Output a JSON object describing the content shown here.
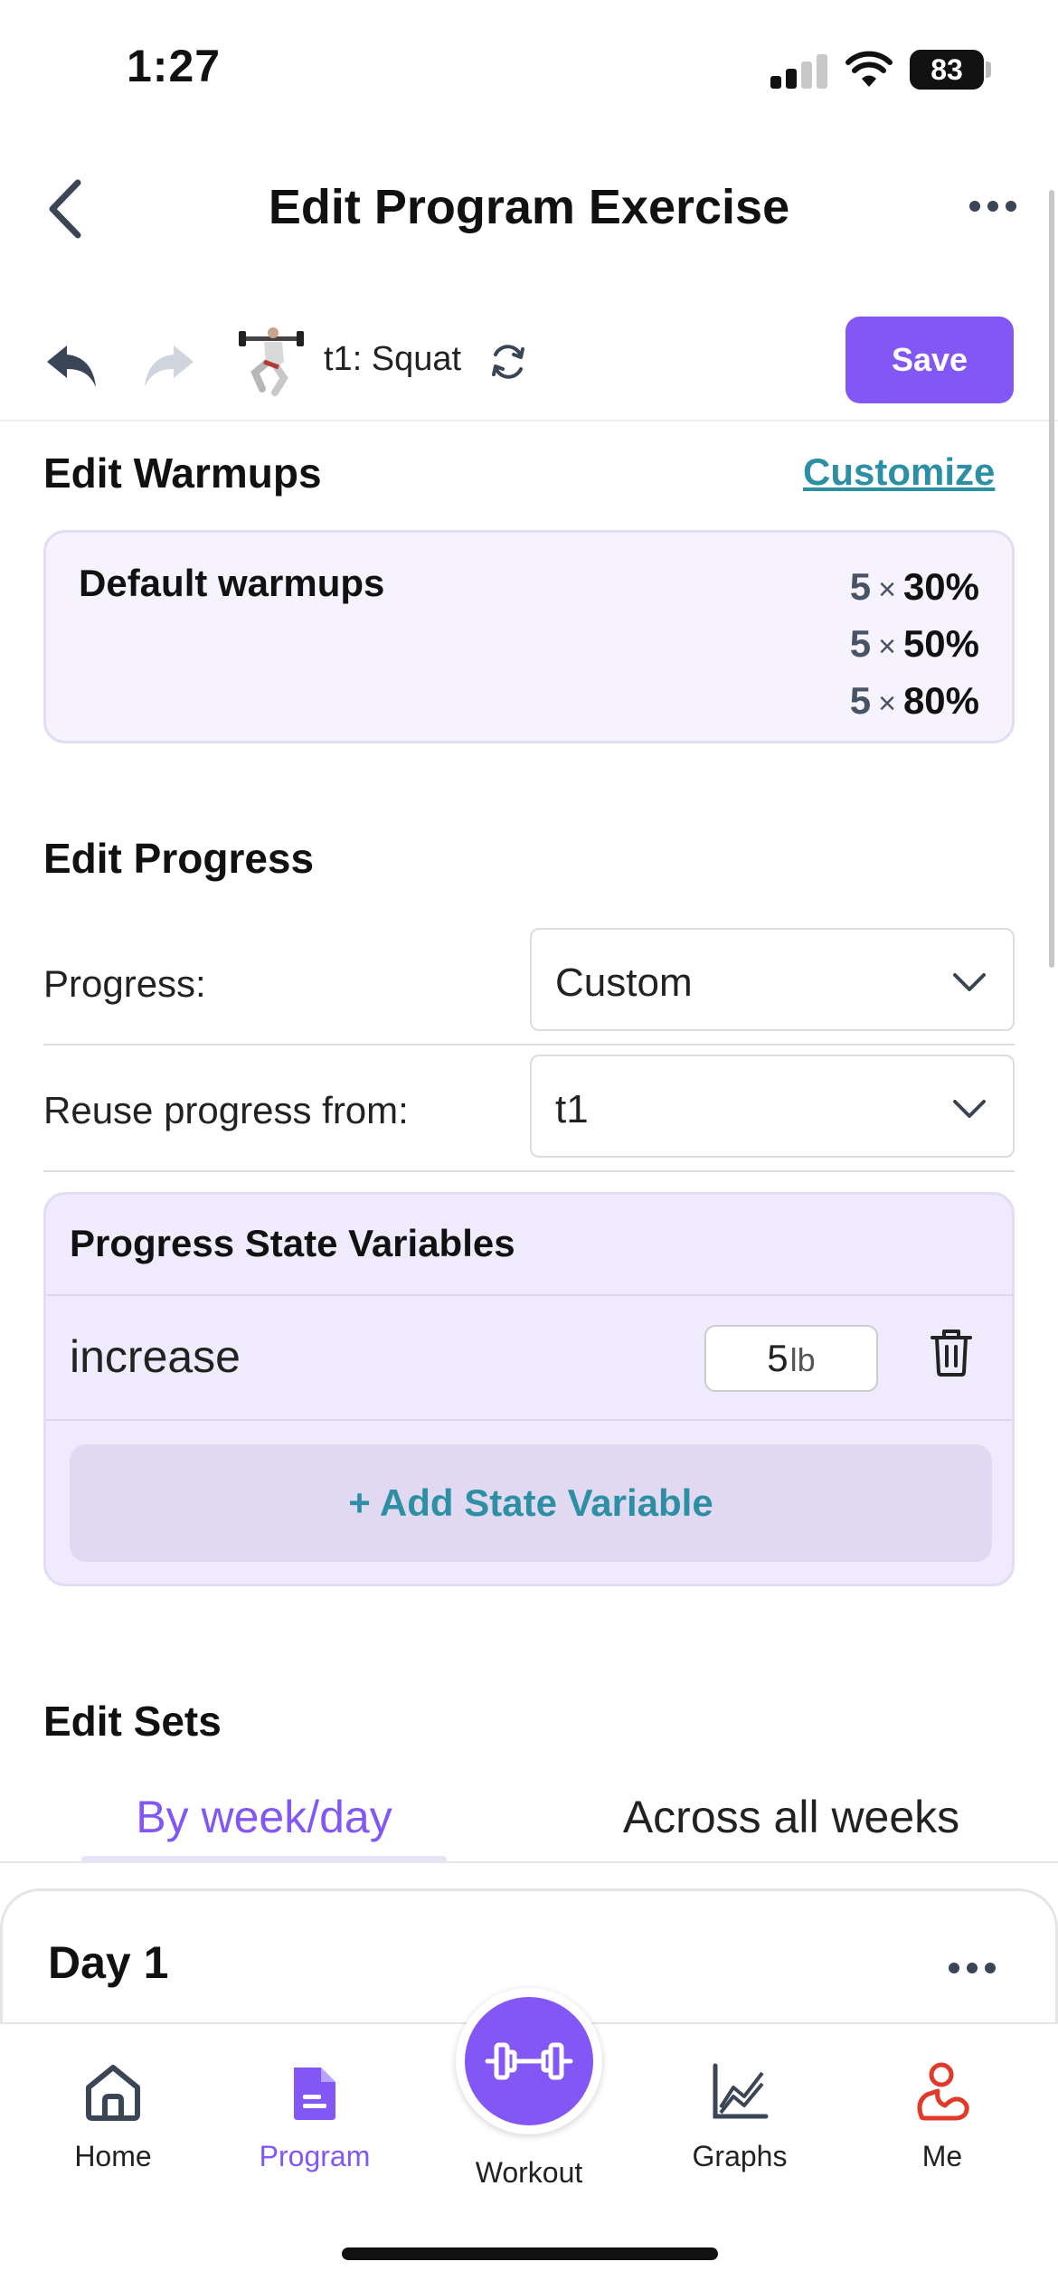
{
  "status_bar": {
    "time": "1:27",
    "battery": "83"
  },
  "header": {
    "title": "Edit Program Exercise",
    "back_icon": "chevron-left-icon",
    "more_icon": "ellipsis-icon"
  },
  "toolbar": {
    "undo_icon": "undo-icon",
    "redo_icon": "redo-icon",
    "exercise_name": "t1: Squat",
    "swap_icon": "refresh-icon",
    "save_label": "Save",
    "save_color": "#8356f6"
  },
  "warmups": {
    "title": "Edit Warmups",
    "customize_label": "Customize",
    "card_label": "Default warmups",
    "rows": [
      {
        "reps": "5",
        "x": "×",
        "pct": "30%"
      },
      {
        "reps": "5",
        "x": "×",
        "pct": "50%"
      },
      {
        "reps": "5",
        "x": "×",
        "pct": "80%"
      }
    ]
  },
  "progress": {
    "title": "Edit Progress",
    "progress_label": "Progress:",
    "progress_value": "Custom",
    "reuse_label": "Reuse progress from:",
    "reuse_value": "t1",
    "state_vars_title": "Progress State Variables",
    "state_vars": [
      {
        "name": "increase",
        "value": "5",
        "unit": "lb"
      }
    ],
    "add_state_label": "+ Add State Variable"
  },
  "sets": {
    "title": "Edit Sets",
    "tab_active": "By week/day",
    "tab_inactive": "Across all weeks",
    "day_title": "Day 1"
  },
  "bottom_nav": {
    "items": [
      {
        "label": "Home",
        "icon": "home-icon"
      },
      {
        "label": "Program",
        "icon": "document-icon"
      },
      {
        "label": "Workout",
        "icon": "dumbbell-icon"
      },
      {
        "label": "Graphs",
        "icon": "chart-icon"
      },
      {
        "label": "Me",
        "icon": "user-icon"
      }
    ],
    "accent": "#8356f6",
    "me_color": "#e03a2b"
  }
}
